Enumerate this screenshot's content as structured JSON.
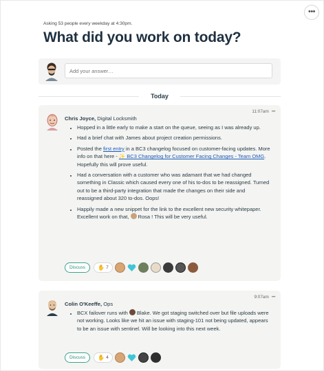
{
  "header": {
    "schedule": "Asking 53 people every weekday at 4:30pm.",
    "question": "What did you work on today?",
    "more_label": "•••"
  },
  "answer": {
    "placeholder": "Add your answer…"
  },
  "day": {
    "label": "Today"
  },
  "posts": [
    {
      "time": "11:07am",
      "menu": "•••",
      "author_name": "Chris Joyce,",
      "author_title": "Digital Locksmith",
      "bullets": {
        "b1": "Hopped in a little early to make a start on the queue, seeing as I was already up.",
        "b2": "Had a brief chat with James about project creation permissions.",
        "b3_pre": "Posted the ",
        "b3_link": "first entry",
        "b3_mid": " in a BC3 changelog focused on customer-facing updates. More info on that here - ",
        "b3_link2": "✨ BC3 Changelog for Customer Facing Changes - Team OMG",
        "b3_post": ". Hopefully this will prove useful.",
        "b4": "Had a conversation with a customer who was adamant that we had changed something in Classic which caused every one of his to-dos to be reassigned. Turned out to be a third-party integration that made the changes on their side and reassigned about 320 to-dos. Oops!",
        "b5_pre": "Happily made a new snippet for the link to the excellent new security whitepaper. Excellent work on that, ",
        "b5_name": "Rosa",
        "b5_post": " ! This will be very useful."
      },
      "discuss_label": "Discuss",
      "boost_count": "7"
    },
    {
      "time": "9:07am",
      "menu": "•••",
      "author_name": "Colin O'Keeffe,",
      "author_title": "Ops",
      "bullets": {
        "b1_pre": "BCX failover runs with ",
        "b1_name": "Blake",
        "b1_post": ". We got staging switched over but file uploads were not working. Looks like we hit an issue with staging-101 not being updated, appears to be an issue with sentinel. Will be looking into this next week."
      },
      "discuss_label": "Discuss",
      "boost_count": "4"
    }
  ],
  "colors": {
    "accent_green": "#3aa38c",
    "link_blue": "#1a5bb8",
    "heart": "#3ec6d6",
    "card_bg": "#f4f4f2"
  },
  "icons": {
    "more": "ellipsis-icon",
    "boost": "clapping-hands-icon",
    "heart": "heart-icon"
  }
}
